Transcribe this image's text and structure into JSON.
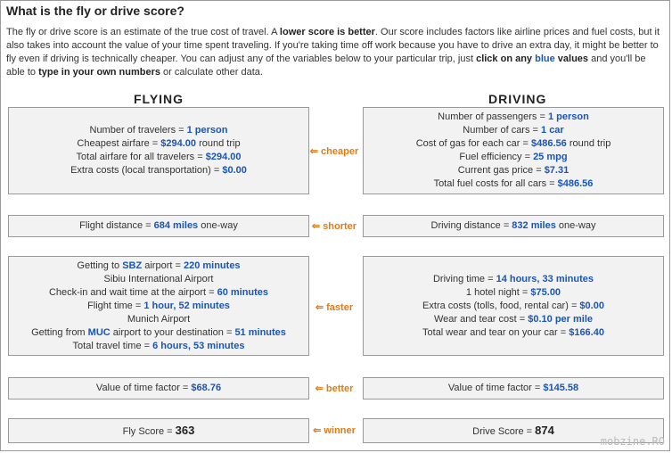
{
  "title": "What is the fly or drive score?",
  "intro": {
    "p1": "The fly or drive score is an estimate of the true cost of travel. A ",
    "b1": "lower score is better",
    "p2": ". Our score includes factors like airline prices and fuel costs, but it also takes into account the value of your time spent traveling. If you're taking time off work because you have to drive an extra day, it might be better to fly even if driving is technically cheaper. You can adjust any of the variables below to your particular trip, just ",
    "b2": "click on any ",
    "blue": "blue",
    "b3": " values",
    "p3": " and you'll be able to ",
    "b4": "type in your own numbers",
    "p4": " or calculate other data."
  },
  "flying_heading": "FLYING",
  "driving_heading": "DRIVING",
  "comparisons": {
    "cost": "⇐ cheaper",
    "distance": "⇐ shorter",
    "time": "⇐ faster",
    "value": "⇐ better",
    "score": "⇐ winner"
  },
  "fly": {
    "cost": [
      {
        "label": "Number of travelers = ",
        "value": "1 person",
        "suffix": ""
      },
      {
        "label": "Cheapest airfare = ",
        "value": "$294.00",
        "suffix": " round trip"
      },
      {
        "label": "Total airfare for all travelers = ",
        "value": "$294.00",
        "suffix": ""
      },
      {
        "label": "Extra costs (local transportation) = ",
        "value": "$0.00",
        "suffix": ""
      }
    ],
    "distance": {
      "label": "Flight distance = ",
      "value": "684 miles",
      "suffix": " one-way"
    },
    "time": [
      {
        "label": "Getting to ",
        "value": "SBZ",
        "label2": " airport = ",
        "value2": "220 minutes"
      },
      {
        "label": "Sibiu International Airport"
      },
      {
        "label": "Check-in and wait time at the airport = ",
        "value": "60 minutes"
      },
      {
        "label": "Flight time = ",
        "value": "1 hour, 52 minutes"
      },
      {
        "label": "Munich Airport"
      },
      {
        "label": "Getting from ",
        "value": "MUC",
        "label2": " airport to your destination = ",
        "value2": "51 minutes"
      },
      {
        "label": "Total travel time = ",
        "value": "6 hours, 53 minutes"
      }
    ],
    "value": {
      "label": "Value of time factor = ",
      "value": "$68.76"
    },
    "score": {
      "label": "Fly Score = ",
      "value": "363"
    }
  },
  "drive": {
    "cost": [
      {
        "label": "Number of passengers = ",
        "value": "1 person",
        "suffix": ""
      },
      {
        "label": "Number of cars = ",
        "value": "1 car",
        "suffix": ""
      },
      {
        "label": "Cost of gas for each car = ",
        "value": "$486.56",
        "suffix": " round trip"
      },
      {
        "label": "Fuel efficiency = ",
        "value": "25 mpg",
        "suffix": ""
      },
      {
        "label": "Current gas price = ",
        "value": "$7.31",
        "suffix": ""
      },
      {
        "label": "Total fuel costs for all cars = ",
        "value": "$486.56",
        "suffix": ""
      }
    ],
    "distance": {
      "label": "Driving distance = ",
      "value": "832 miles",
      "suffix": " one-way"
    },
    "time": [
      {
        "label": "Driving time = ",
        "value": "14 hours, 33 minutes"
      },
      {
        "label": "1 hotel night = ",
        "value": "$75.00"
      },
      {
        "label": "Extra costs (tolls, food, rental car) = ",
        "value": "$0.00"
      },
      {
        "label": "Wear and tear cost = ",
        "value": "$0.10 per mile"
      },
      {
        "label": "Total wear and tear on your car = ",
        "value": "$166.40"
      }
    ],
    "value": {
      "label": "Value of time factor = ",
      "value": "$145.58"
    },
    "score": {
      "label": "Drive Score = ",
      "value": "874"
    }
  },
  "watermark": "mobzine.RO",
  "colors": {
    "link_blue": "#1a56b5",
    "orange": "#e07b17",
    "box_bg": "#f2f2f2"
  }
}
